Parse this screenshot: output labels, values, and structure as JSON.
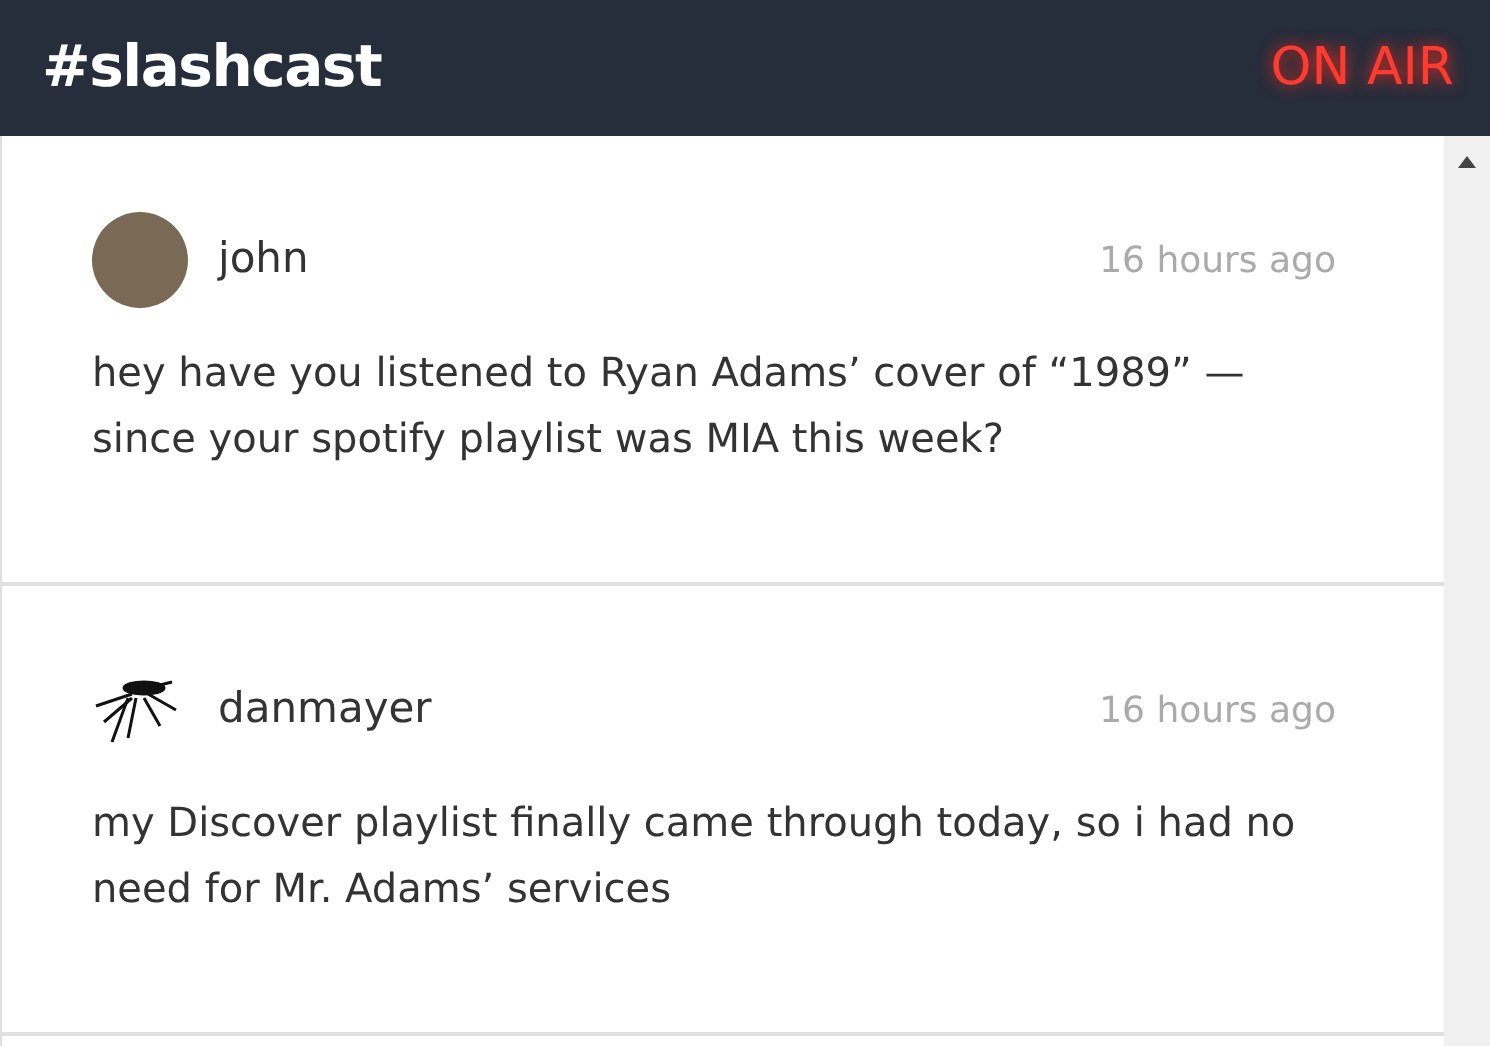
{
  "header": {
    "title": "#slashcast",
    "on_air": {
      "label": "ON AIR",
      "lit": true
    }
  },
  "messages": [
    {
      "author": "john",
      "avatar": {
        "kind": "photo"
      },
      "time": "16 hours ago",
      "text": "hey have you listened to Ryan Adams’ cover of “1989” — since your spotify playlist was MIA this week?"
    },
    {
      "author": "danmayer",
      "avatar": {
        "kind": "insect"
      },
      "time": "16 hours ago",
      "text": "my Discover playlist finally came through today, so i had no need for Mr. Adams’ services"
    }
  ]
}
